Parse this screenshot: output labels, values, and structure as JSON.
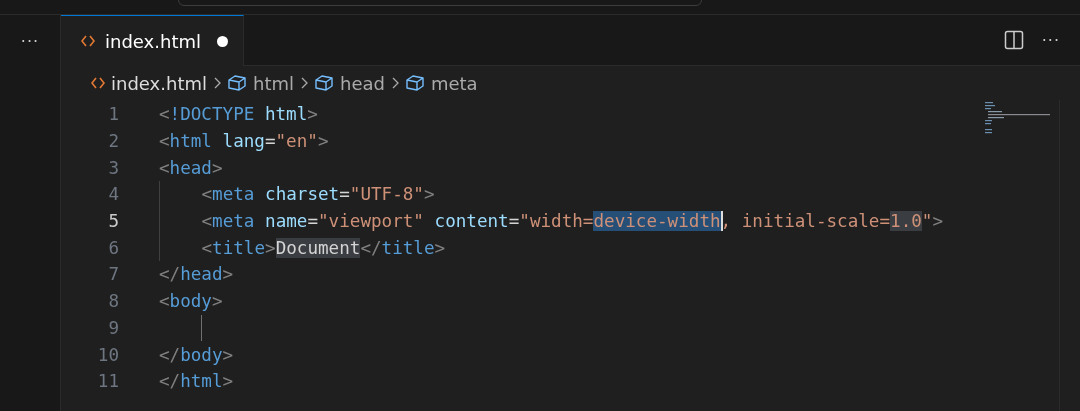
{
  "sidebar": {
    "more_label": "···"
  },
  "tabs": [
    {
      "label": "index.html",
      "selected": true,
      "modified": true
    }
  ],
  "editor_actions": {
    "more_label": "···"
  },
  "breadcrumb": [
    {
      "label": "index.html",
      "kind": "file"
    },
    {
      "label": "html",
      "kind": "element"
    },
    {
      "label": "head",
      "kind": "element"
    },
    {
      "label": "meta",
      "kind": "element"
    }
  ],
  "code_lines": [
    {
      "number": "1",
      "active": false,
      "indented": false,
      "tokens": [
        {
          "text": "<",
          "kind": "punct"
        },
        {
          "text": "!DOCTYPE",
          "kind": "tag"
        },
        {
          "text": " html",
          "kind": "attr"
        },
        {
          "text": ">",
          "kind": "punct"
        }
      ]
    },
    {
      "number": "2",
      "active": false,
      "indented": false,
      "tokens": [
        {
          "text": "<",
          "kind": "punct"
        },
        {
          "text": "html",
          "kind": "tag"
        },
        {
          "text": " lang",
          "kind": "attr"
        },
        {
          "text": "=",
          "kind": "text"
        },
        {
          "text": "\"en\"",
          "kind": "string"
        },
        {
          "text": ">",
          "kind": "punct"
        }
      ]
    },
    {
      "number": "3",
      "active": false,
      "indented": false,
      "tokens": [
        {
          "text": "<",
          "kind": "punct"
        },
        {
          "text": "head",
          "kind": "tag"
        },
        {
          "text": ">",
          "kind": "punct"
        }
      ]
    },
    {
      "number": "4",
      "active": false,
      "indented": true,
      "tokens": [
        {
          "text": "<",
          "kind": "punct"
        },
        {
          "text": "meta",
          "kind": "tag"
        },
        {
          "text": " charset",
          "kind": "attr"
        },
        {
          "text": "=",
          "kind": "text"
        },
        {
          "text": "\"UTF-8\"",
          "kind": "string"
        },
        {
          "text": ">",
          "kind": "punct"
        }
      ]
    },
    {
      "number": "5",
      "active": true,
      "indented": true,
      "tokens": [
        {
          "text": "<",
          "kind": "punct"
        },
        {
          "text": "meta",
          "kind": "tag"
        },
        {
          "text": " name",
          "kind": "attr"
        },
        {
          "text": "=",
          "kind": "text"
        },
        {
          "text": "\"viewport\"",
          "kind": "string"
        },
        {
          "text": " content",
          "kind": "attr"
        },
        {
          "text": "=",
          "kind": "text"
        },
        {
          "text": "\"width=",
          "kind": "string"
        },
        {
          "text": "device-width",
          "kind": "string",
          "selected": true,
          "cursor": true
        },
        {
          "text": ", initial-scale=",
          "kind": "string"
        },
        {
          "text": "1.0",
          "kind": "string",
          "highlighted": true
        },
        {
          "text": "\"",
          "kind": "string"
        },
        {
          "text": ">",
          "kind": "punct"
        }
      ]
    },
    {
      "number": "6",
      "active": false,
      "indented": true,
      "tokens": [
        {
          "text": "<",
          "kind": "punct"
        },
        {
          "text": "title",
          "kind": "tag"
        },
        {
          "text": ">",
          "kind": "punct"
        },
        {
          "text": "Document",
          "kind": "text",
          "highlighted": true
        },
        {
          "text": "</",
          "kind": "punct"
        },
        {
          "text": "title",
          "kind": "tag"
        },
        {
          "text": ">",
          "kind": "punct"
        }
      ]
    },
    {
      "number": "7",
      "active": false,
      "indented": false,
      "tokens": [
        {
          "text": "</",
          "kind": "punct"
        },
        {
          "text": "head",
          "kind": "tag"
        },
        {
          "text": ">",
          "kind": "punct"
        }
      ]
    },
    {
      "number": "8",
      "active": false,
      "indented": false,
      "tokens": [
        {
          "text": "<",
          "kind": "punct"
        },
        {
          "text": "body",
          "kind": "tag"
        },
        {
          "text": ">",
          "kind": "punct"
        }
      ]
    },
    {
      "number": "9",
      "active": false,
      "indented": true
    },
    {
      "number": "10",
      "active": false,
      "indented": false,
      "tokens": [
        {
          "text": "</",
          "kind": "punct"
        },
        {
          "text": "body",
          "kind": "tag"
        },
        {
          "text": ">",
          "kind": "punct"
        }
      ]
    },
    {
      "number": "11",
      "active": false,
      "indented": false,
      "tokens": [
        {
          "text": "</",
          "kind": "punct"
        },
        {
          "text": "html",
          "kind": "tag"
        },
        {
          "text": ">",
          "kind": "punct"
        }
      ]
    }
  ]
}
